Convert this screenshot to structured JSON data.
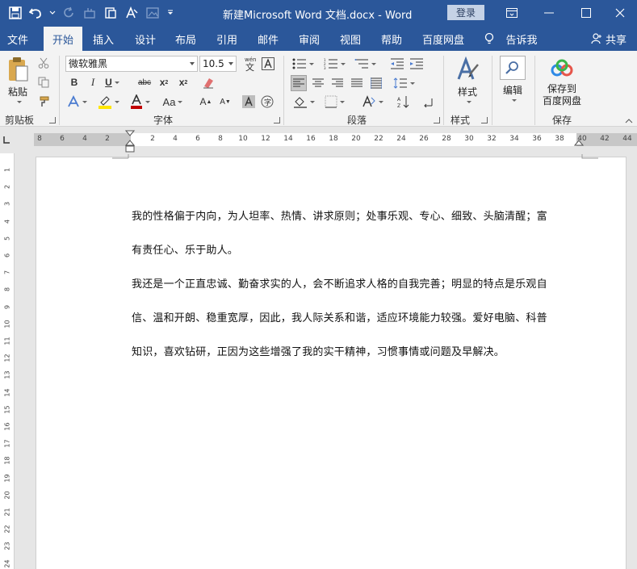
{
  "app": {
    "title": "新建Microsoft Word 文档.docx - Word",
    "login_label": "登录"
  },
  "tabs": [
    {
      "label": "文件"
    },
    {
      "label": "开始",
      "active": true
    },
    {
      "label": "插入"
    },
    {
      "label": "设计"
    },
    {
      "label": "布局"
    },
    {
      "label": "引用"
    },
    {
      "label": "邮件"
    },
    {
      "label": "审阅"
    },
    {
      "label": "视图"
    },
    {
      "label": "帮助"
    },
    {
      "label": "百度网盘"
    },
    {
      "label": "告诉我"
    }
  ],
  "share_label": "共享",
  "ribbon": {
    "clipboard": {
      "paste_label": "粘贴",
      "group_label": "剪贴板"
    },
    "font": {
      "font_name": "微软雅黑",
      "font_size": "10.5",
      "group_label": "字体"
    },
    "paragraph": {
      "group_label": "段落"
    },
    "styles": {
      "button_label": "样式",
      "group_label": "样式"
    },
    "editing": {
      "button_label": "编辑"
    },
    "save": {
      "button_label_1": "保存到",
      "button_label_2": "百度网盘",
      "group_label": "保存"
    }
  },
  "ruler": {
    "h_numbers": [
      "8",
      "6",
      "4",
      "2",
      "2",
      "4",
      "6",
      "8",
      "10",
      "12",
      "14",
      "16",
      "18",
      "20",
      "22",
      "24",
      "26",
      "28",
      "30",
      "32",
      "34",
      "36",
      "38",
      "40",
      "42",
      "44"
    ],
    "v_numbers": [
      "1",
      "2",
      "3",
      "4",
      "5",
      "6",
      "7",
      "8",
      "9",
      "10",
      "11",
      "12",
      "13",
      "14",
      "15",
      "16",
      "17",
      "18",
      "19",
      "20",
      "21",
      "22",
      "23",
      "24"
    ]
  },
  "document": {
    "lines": [
      "我的性格偏于内向，为人坦率、热情、讲求原则；处事乐观、专心、细致、头脑清醒；富",
      "有责任心、乐于助人。",
      "我还是一个正直忠诚、勤奋求实的人，会不断追求人格的自我完善；明显的特点是乐观自",
      "信、温和开朗、稳重宽厚，因此，我人际关系和谐，适应环境能力较强。爱好电脑、科普",
      "知识，喜欢钻研，正因为这些增强了我的实干精神，习惯事情或问题及早解决。"
    ]
  },
  "colors": {
    "brand": "#2b579a",
    "ribbon_bg": "#f3f3f3"
  }
}
